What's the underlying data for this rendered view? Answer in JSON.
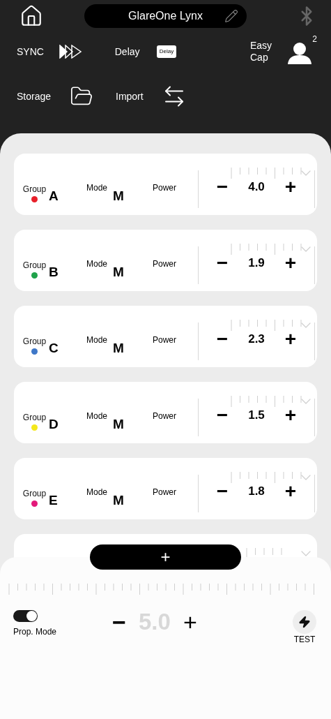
{
  "header": {
    "device_name": "GlareOne Lynx"
  },
  "actions": [
    {
      "kind": "sync",
      "label": "SYNC"
    },
    {
      "kind": "delay",
      "label": "Delay",
      "badge": "Delay"
    },
    {
      "kind": "easycap",
      "label": "Easy Cap",
      "count": "2"
    },
    {
      "kind": "storage",
      "label": "Storage"
    },
    {
      "kind": "import",
      "label": "Import"
    }
  ],
  "groups": [
    {
      "group_label": "Group",
      "group": "A",
      "color": "#e8202a",
      "mode_label": "Mode",
      "mode": "M",
      "power_label": "Power",
      "minus": "−",
      "value": "4.0",
      "plus": "+"
    },
    {
      "group_label": "Group",
      "group": "B",
      "color": "#1fa24a",
      "mode_label": "Mode",
      "mode": "M",
      "power_label": "Power",
      "minus": "−",
      "value": "1.9",
      "plus": "+"
    },
    {
      "group_label": "Group",
      "group": "C",
      "color": "#3f78c8",
      "mode_label": "Mode",
      "mode": "M",
      "power_label": "Power",
      "minus": "−",
      "value": "2.3",
      "plus": "+"
    },
    {
      "group_label": "Group",
      "group": "D",
      "color": "#f4e81c",
      "mode_label": "Mode",
      "mode": "M",
      "power_label": "Power",
      "minus": "−",
      "value": "1.5",
      "plus": "+"
    },
    {
      "group_label": "Group",
      "group": "E",
      "color": "#e3197a",
      "mode_label": "Mode",
      "mode": "M",
      "power_label": "Power",
      "minus": "−",
      "value": "1.8",
      "plus": "+"
    }
  ],
  "add_button": "+",
  "master": {
    "prop_mode": {
      "label": "Prop. Mode",
      "on": true
    },
    "minus": "−",
    "value": "5.0",
    "dimmed": true,
    "plus": "+",
    "test_label": "TEST"
  }
}
